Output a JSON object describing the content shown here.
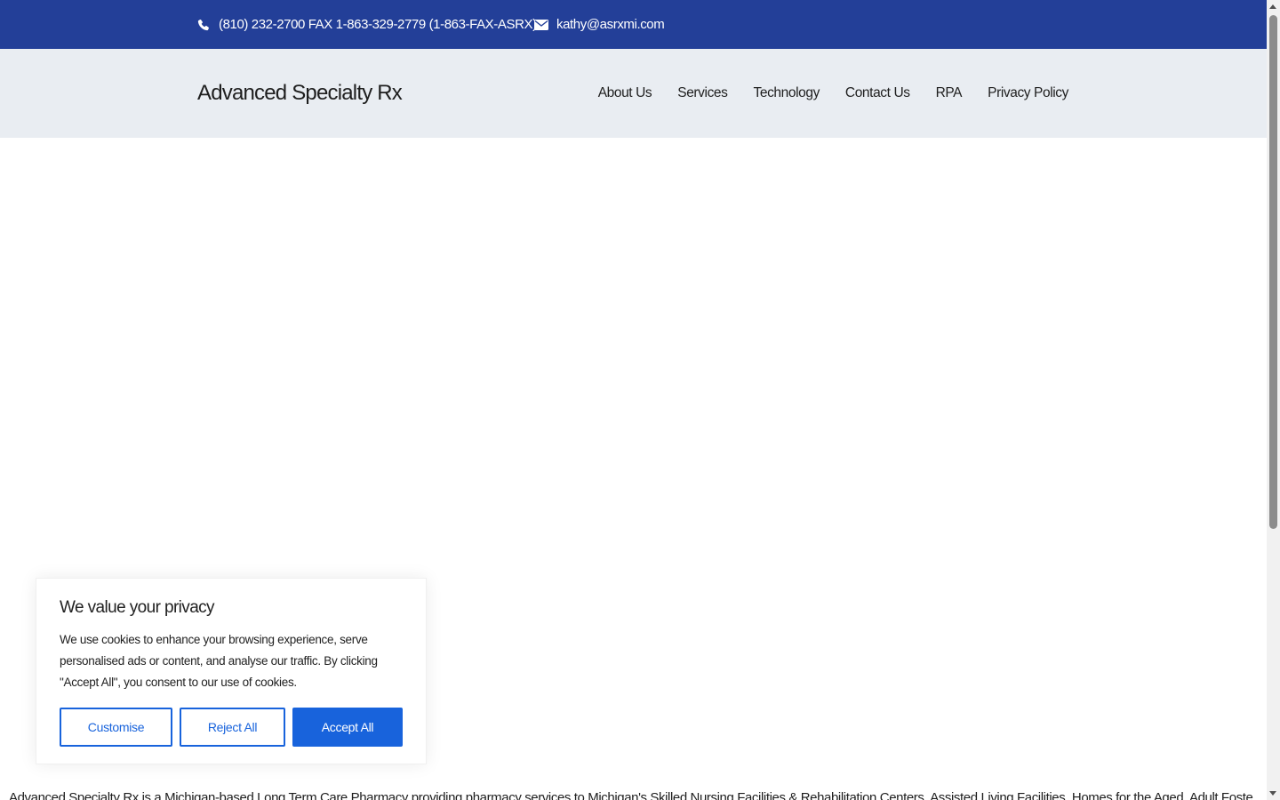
{
  "topbar": {
    "phone_text": "(810) 232-2700 FAX 1-863-329-2779 (1-863-FAX-ASRX)",
    "email_text": "kathy@asrxmi.com",
    "icons": {
      "phone": "phone-icon",
      "email": "envelope-icon"
    },
    "background_color": "#233f98"
  },
  "header": {
    "brand": "Advanced Specialty Rx",
    "nav": [
      "About Us",
      "Services",
      "Technology",
      "Contact Us",
      "RPA",
      "Privacy Policy"
    ],
    "background_color": "#e9edf2"
  },
  "cookie_banner": {
    "title": "We value your privacy",
    "body": "We use cookies to enhance your browsing experience, serve personalised ads or content, and analyse our traffic. By clicking \"Accept All\", you consent to our use of cookies.",
    "buttons": {
      "customise": "Customise",
      "reject": "Reject All",
      "accept": "Accept All"
    },
    "accent_color": "#1863dc"
  },
  "footer_text": "Advanced Specialty Rx is a Michigan-based Long Term Care Pharmacy providing pharmacy services to Michigan's Skilled Nursing Facilities & Rehabilitation Centers, Assisted Living Facilities, Homes for the Aged, Adult Foster Care"
}
